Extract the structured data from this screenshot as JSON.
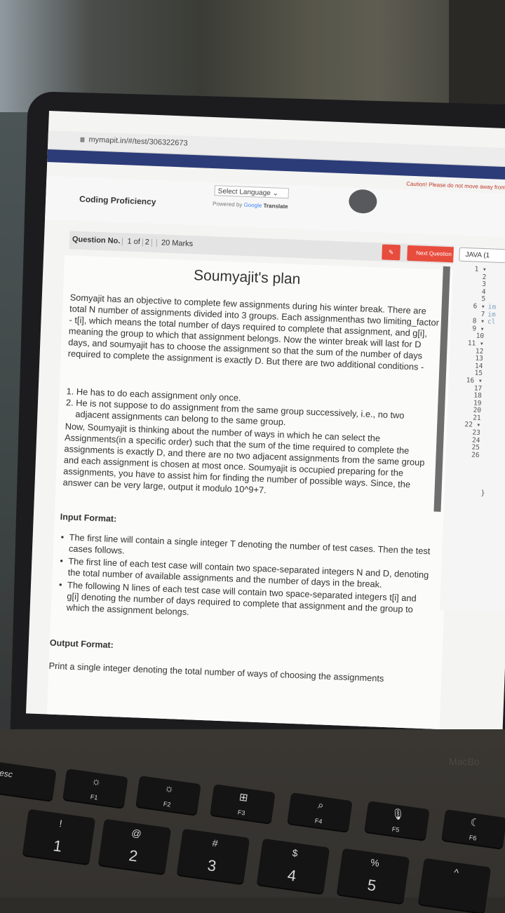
{
  "browser": {
    "url": "mymapit.in/#/test/306322673",
    "caution": "Caution! Please do not move away from the w"
  },
  "header": {
    "section": "Coding Proficiency",
    "language_select": "Select Language",
    "powered_prefix": "Powered by",
    "powered_brand": "Google",
    "powered_suffix": "Translate"
  },
  "question_bar": {
    "label": "Question No.",
    "current": "1 of",
    "total": "2",
    "marks": "20 Marks",
    "next_button": "Next Question"
  },
  "problem": {
    "title": "Soumyajit's plan",
    "intro": "Somyajit has an objective to complete few assignments during his winter break. There are total N number of assignments divided into 3 groups. Each assignmenthas two limiting_factor - t[i], which means the total number of days required to complete that assignment, and g[i], meaning the group to which that assignment belongs. Now the winter break will last for D days, and soumyajit has to choose the assignment so that the sum of the number of days required to complete the assignment is exactly D. But there are two additional conditions -",
    "conditions": [
      "1. He has to do each assignment only once.",
      "2. He is not suppose to do assignment from the same group successively, i.e., no two adjacent assignments can belong to the same group."
    ],
    "body": "Now, Soumyajit is thinking about the number of ways in which he can select the Assignments(in a specific order) such that the sum of the time required to complete the assignments is exactly D, and there are no two adjacent assignments from the same group and each assignment is chosen at most once. Soumyajit is occupied preparing for the assignments, you have to assist him for finding the number of possible ways. Since, the answer can be very large, output it modulo 10^9+7.",
    "input_heading": "Input Format:",
    "input_items": [
      "The first line will contain a single integer T denoting the number of test cases. Then the test cases follows.",
      "The first line of each test case will contain two space-separated integers N and D, denoting the total number of available assignments and the number of days in the break.",
      "The following N lines of each test case will contain two space-separated integers t[i] and g[i] denoting the number of days required to complete that assignment and the group to which the assignment belongs."
    ],
    "output_heading": "Output Format:",
    "output_text": "Print a single integer denoting the total number of ways of choosing the assignments"
  },
  "editor": {
    "language": "JAVA (1",
    "line_numbers": [
      "1",
      "2",
      "3",
      "4",
      "5",
      "6",
      "7",
      "8",
      "9",
      "10",
      "11",
      "12",
      "13",
      "14",
      "15",
      "16",
      "17",
      "18",
      "19",
      "20",
      "21",
      "22",
      "23",
      "24",
      "25",
      "26"
    ],
    "fold_lines": [
      "1",
      "6",
      "8",
      "9",
      "11",
      "16",
      "22"
    ],
    "code_fragments": {
      "6": "im",
      "7": "im",
      "8": "cl"
    },
    "closing_brace": "}"
  },
  "keyboard": {
    "brand": "MacBo",
    "keys": [
      {
        "top": "esc",
        "bottom": ""
      },
      {
        "top": "☼",
        "bottom": "F1"
      },
      {
        "top": "☼",
        "bottom": "F2"
      },
      {
        "top": "⊞",
        "bottom": "F3"
      },
      {
        "top": "⌕",
        "bottom": "F4"
      },
      {
        "top": "🎙",
        "bottom": "F5"
      },
      {
        "top": "☾",
        "bottom": "F6"
      },
      {
        "top": "!",
        "bottom": "1"
      },
      {
        "top": "@",
        "bottom": "2"
      },
      {
        "top": "#",
        "bottom": "3"
      },
      {
        "top": "$",
        "bottom": "4"
      },
      {
        "top": "%",
        "bottom": "5"
      },
      {
        "top": "^",
        "bottom": ""
      }
    ]
  }
}
